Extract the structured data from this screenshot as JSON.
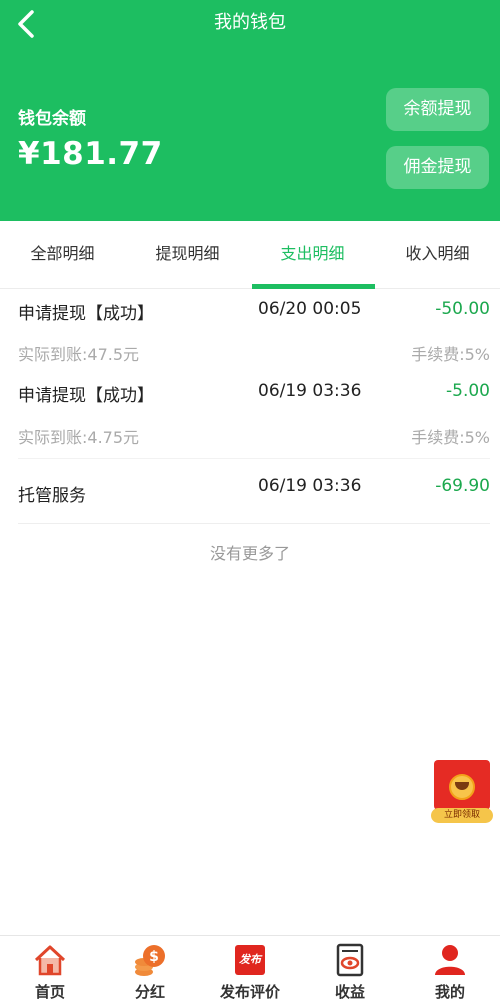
{
  "header": {
    "title": "我的钱包",
    "balance_label": "钱包余额",
    "balance_value": "¥181.77",
    "btn_balance_withdraw": "余额提现",
    "btn_commission_withdraw": "佣金提现",
    "bg_color": "#1dbe61"
  },
  "tabs": [
    {
      "label": "全部明细",
      "active": false
    },
    {
      "label": "提现明细",
      "active": false
    },
    {
      "label": "支出明细",
      "active": true
    },
    {
      "label": "收入明细",
      "active": false
    }
  ],
  "records": [
    {
      "title": "申请提现【成功】",
      "time": "06/20 00:05",
      "amount": "-50.00",
      "sub": "实际到账:47.5元",
      "fee": "手续费:5%"
    },
    {
      "title": "申请提现【成功】",
      "time": "06/19 03:36",
      "amount": "-5.00",
      "sub": "实际到账:4.75元",
      "fee": "手续费:5%"
    },
    {
      "title": "托管服务",
      "time": "06/19 03:36",
      "amount": "-69.90"
    }
  ],
  "no_more_text": "没有更多了",
  "red_packet": {
    "label": "立即领取",
    "icon": "red-envelope-icon"
  },
  "bottom_nav": [
    {
      "label": "首页",
      "icon": "home-icon"
    },
    {
      "label": "分红",
      "icon": "coins-icon"
    },
    {
      "label": "发布评价",
      "icon": "publish-icon",
      "icon_text": "发布"
    },
    {
      "label": "收益",
      "icon": "earnings-icon"
    },
    {
      "label": "我的",
      "icon": "profile-icon"
    }
  ],
  "colors": {
    "accent": "#1dbe61",
    "amount": "#1ca84e",
    "nav_icon": "#e0462b"
  }
}
